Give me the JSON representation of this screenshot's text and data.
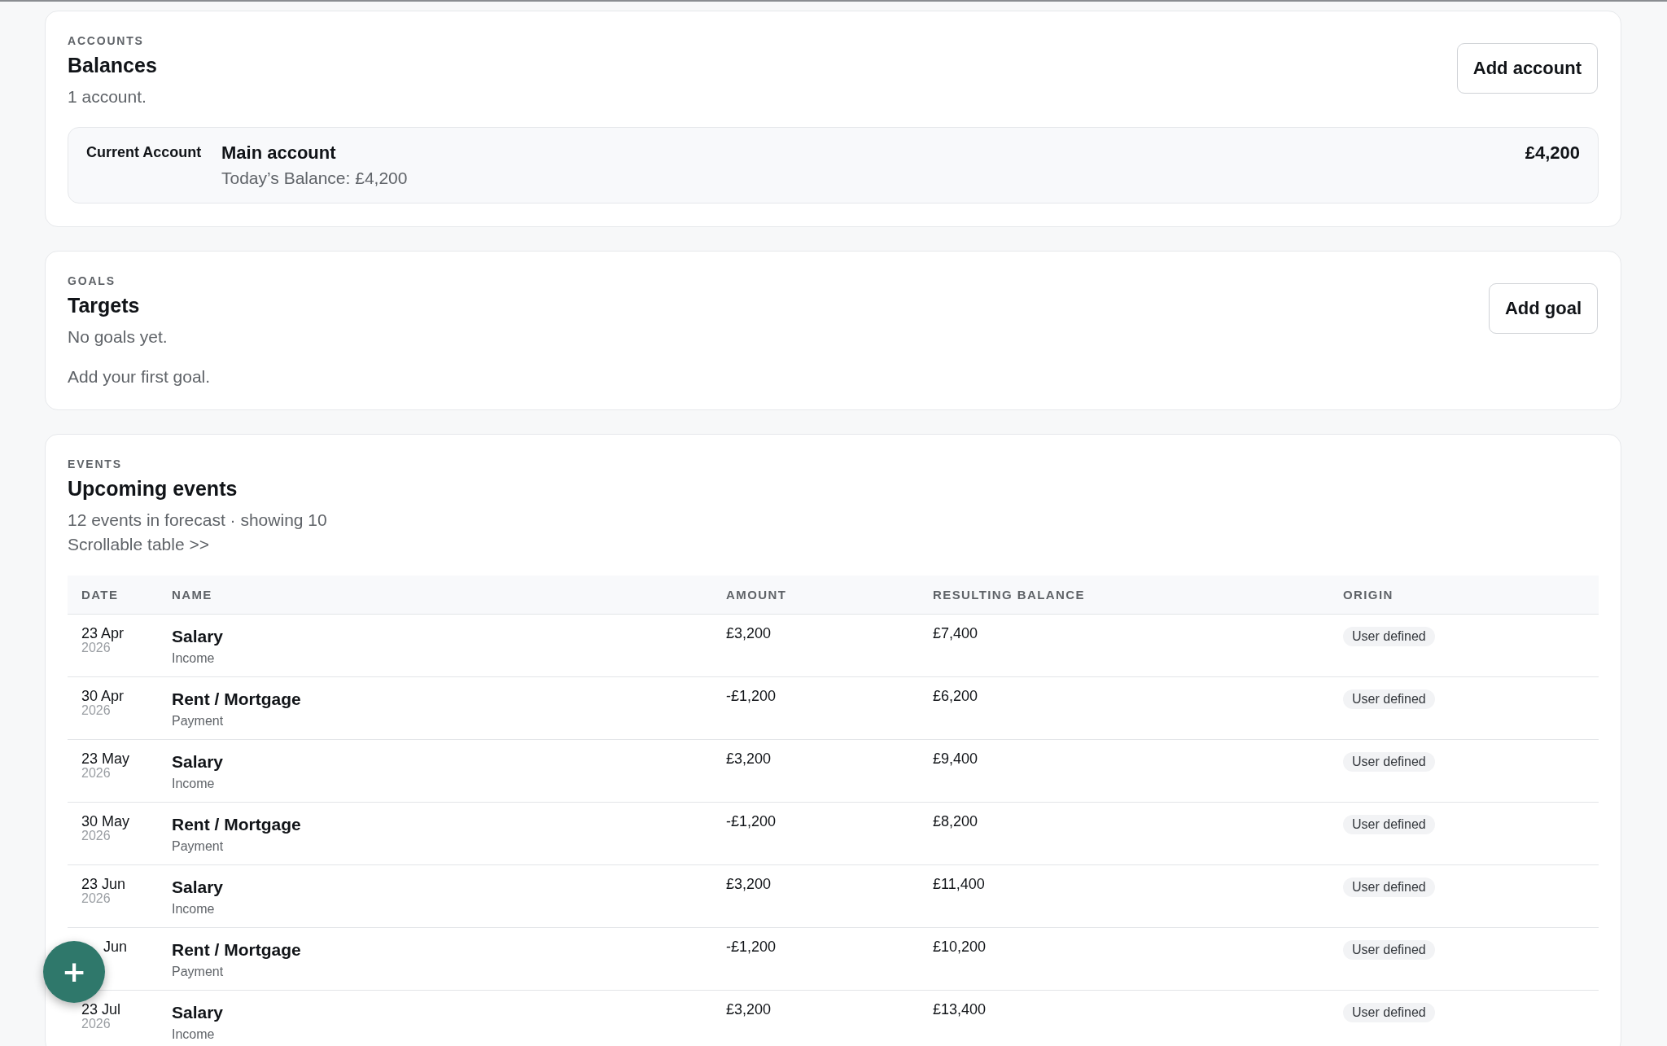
{
  "accounts": {
    "eyebrow": "ACCOUNTS",
    "title": "Balances",
    "summary": "1 account.",
    "button": "Add account",
    "items": [
      {
        "type": "Current Account",
        "name": "Main account",
        "detail": "Today’s Balance: £4,200",
        "balance": "£4,200"
      }
    ]
  },
  "goals": {
    "eyebrow": "GOALS",
    "title": "Targets",
    "summary": "No goals yet.",
    "hint": "Add your first goal.",
    "button": "Add goal"
  },
  "events": {
    "eyebrow": "EVENTS",
    "title": "Upcoming events",
    "summary": "12 events in forecast · showing 10",
    "hint": "Scrollable table >>",
    "table": {
      "columns": [
        "DATE",
        "NAME",
        "AMOUNT",
        "RESULTING BALANCE",
        "ORIGIN"
      ],
      "rows": [
        {
          "date": "23 Apr",
          "year": "2026",
          "name": "Salary",
          "category": "Income",
          "amount": "£3,200",
          "balance": "£7,400",
          "origin": "User defined"
        },
        {
          "date": "30 Apr",
          "year": "2026",
          "name": "Rent / Mortgage",
          "category": "Payment",
          "amount": "-£1,200",
          "balance": "£6,200",
          "origin": "User defined"
        },
        {
          "date": "23 May",
          "year": "2026",
          "name": "Salary",
          "category": "Income",
          "amount": "£3,200",
          "balance": "£9,400",
          "origin": "User defined"
        },
        {
          "date": "30 May",
          "year": "2026",
          "name": "Rent / Mortgage",
          "category": "Payment",
          "amount": "-£1,200",
          "balance": "£8,200",
          "origin": "User defined"
        },
        {
          "date": "23 Jun",
          "year": "2026",
          "name": "Salary",
          "category": "Income",
          "amount": "£3,200",
          "balance": "£11,400",
          "origin": "User defined"
        },
        {
          "date": "Jun",
          "name": "Rent / Mortgage",
          "category": "Payment",
          "amount": "-£1,200",
          "balance": "£10,200",
          "origin": "User defined"
        },
        {
          "date": "23 Jul",
          "year": "2026",
          "name": "Salary",
          "category": "Income",
          "amount": "£3,200",
          "balance": "£13,400",
          "origin": "User defined"
        }
      ]
    }
  },
  "fab": {
    "icon": "+"
  }
}
